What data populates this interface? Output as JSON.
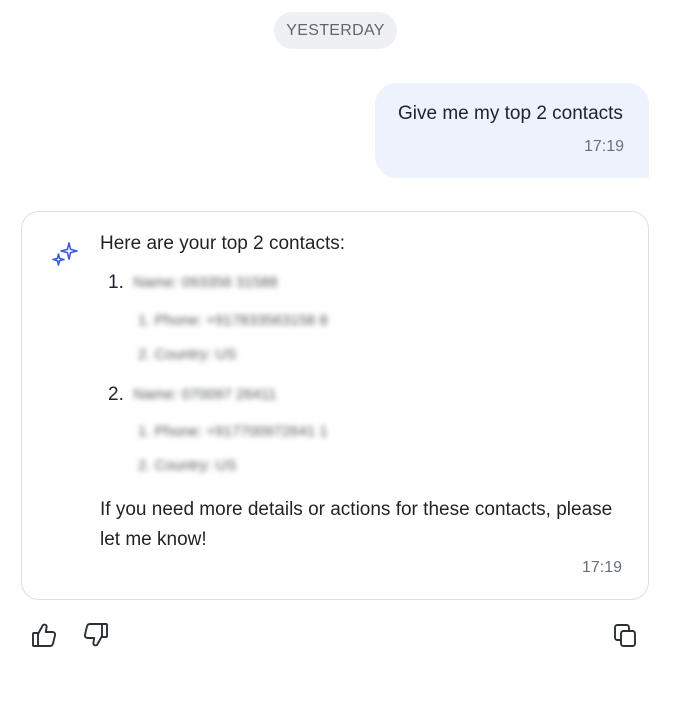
{
  "date_separator": "YESTERDAY",
  "user_message": {
    "text": "Give me my top 2 contacts",
    "time": "17:19"
  },
  "assistant_message": {
    "intro": "Here are your top 2 contacts:",
    "contacts": [
      {
        "number": "1.",
        "name": "Name: 093356 31588",
        "details": [
          "1. Phone: +917833563158 8",
          "2. Country: US"
        ]
      },
      {
        "number": "2.",
        "name": "Name: 070097 26411",
        "details": [
          "1. Phone: +917700972641 1",
          "2. Country: US"
        ]
      }
    ],
    "outro": "If you need more details or actions for these contacts, please let me know!",
    "time": "17:19"
  },
  "actions": {
    "like_icon": "thumbs-up-icon",
    "dislike_icon": "thumbs-down-icon",
    "copy_icon": "copy-icon"
  },
  "colors": {
    "accent": "#3b5bdb",
    "user_bubble": "#edf2fd",
    "pill": "#eef0f3"
  }
}
